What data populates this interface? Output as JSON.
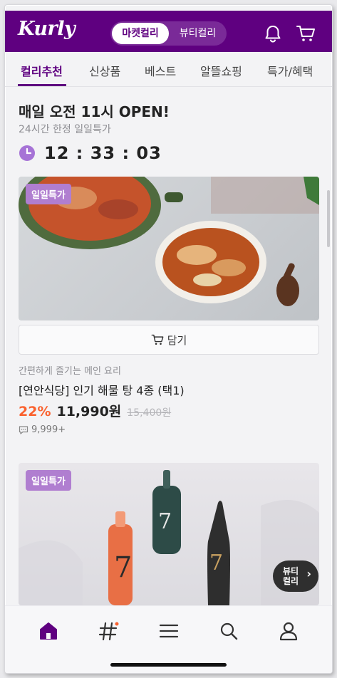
{
  "header": {
    "logo": "Kurly",
    "segment": {
      "active": "마켓컬리",
      "inactive": "뷰티컬리"
    },
    "icons": [
      "bell-icon",
      "cart-icon"
    ],
    "brand_color": "#5f0080"
  },
  "tabs": [
    {
      "label": "컬리추천",
      "active": true
    },
    {
      "label": "신상품",
      "active": false
    },
    {
      "label": "베스트",
      "active": false
    },
    {
      "label": "알뜰쇼핑",
      "active": false
    },
    {
      "label": "특가/혜택",
      "active": false
    }
  ],
  "daily": {
    "title": "매일 오전 11시 OPEN!",
    "subtitle": "24시간 한정 일일특가",
    "timer": "12 : 33 : 03"
  },
  "products": [
    {
      "badge": "일일특가",
      "cart_label": "담기",
      "description": "간편하게 즐기는 메인 요리",
      "name": "[연안식당] 인기 해물 탕 4종 (택1)",
      "discount": "22%",
      "price": "11,990원",
      "original_price": "15,400원",
      "reviews": "9,999+"
    },
    {
      "badge": "일일특가"
    }
  ],
  "beauty_button": {
    "line1": "뷰티",
    "line2": "컬리",
    "chevron": "›"
  },
  "bottom_nav": [
    "home-icon",
    "hashtag-icon",
    "menu-icon",
    "search-icon",
    "profile-icon"
  ],
  "accent_colors": {
    "discount": "#fa622f",
    "badge": "#b07ed0"
  }
}
